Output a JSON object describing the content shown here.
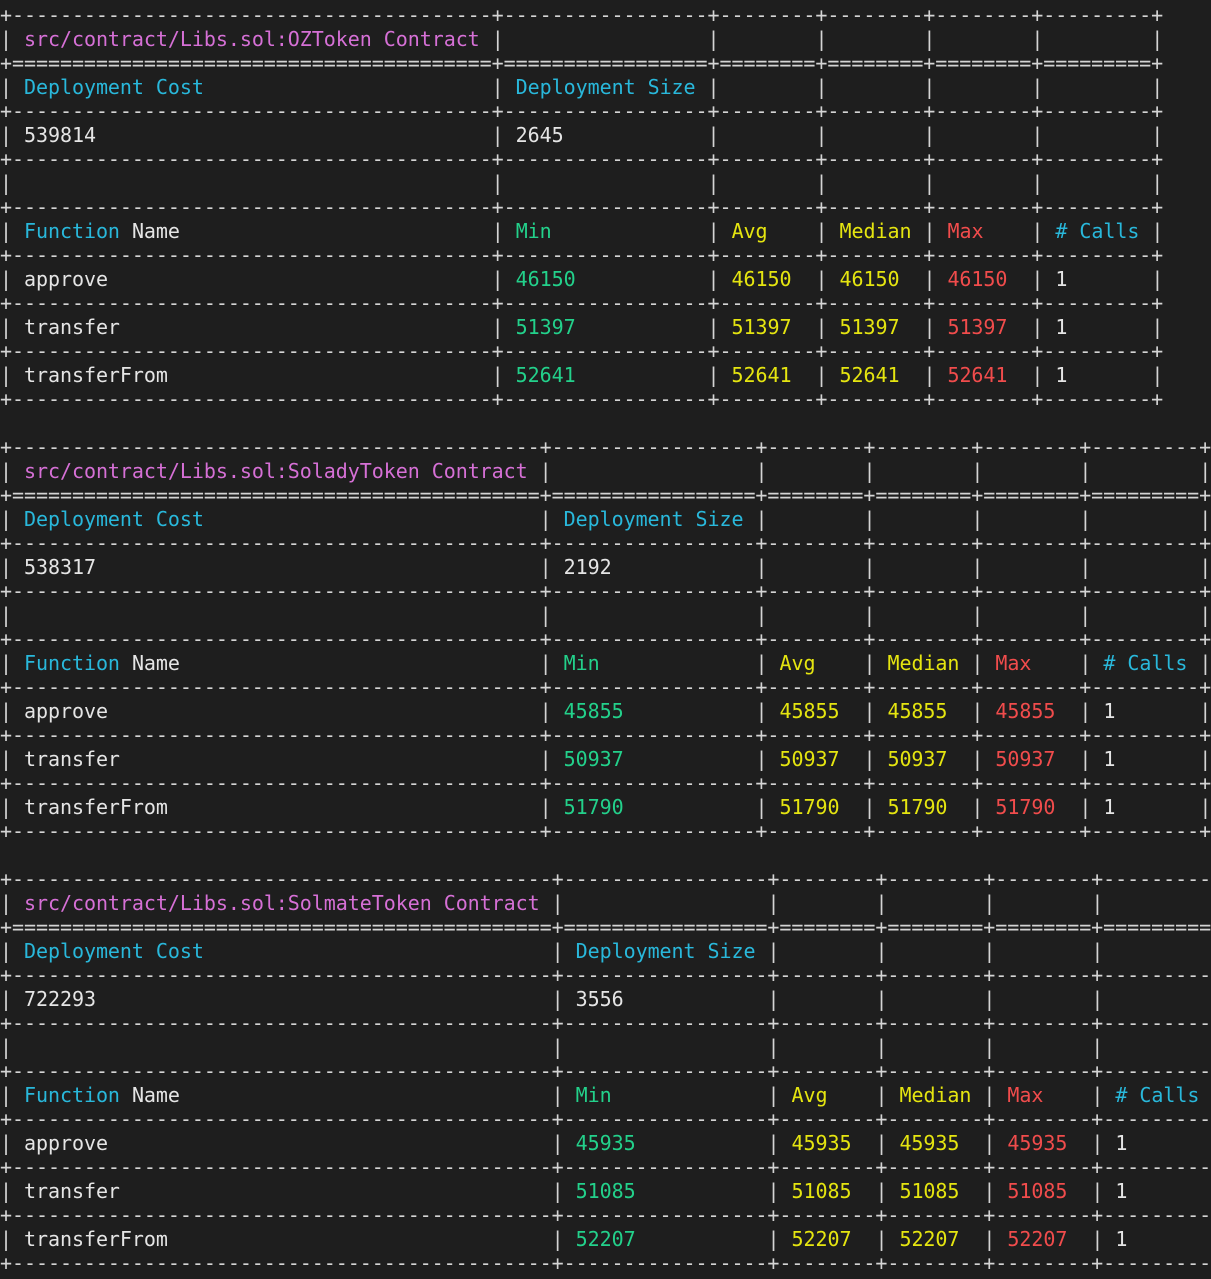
{
  "theme": {
    "background": "#1e1e1e",
    "border": "#d4d4d4",
    "title": "#d670d6",
    "header": "#29b8db",
    "min": "#23d18b",
    "avg_median": "#e5e510",
    "max": "#f14c4c",
    "text": "#e5e5e5"
  },
  "labels": {
    "deployment_cost": "Deployment Cost",
    "deployment_size": "Deployment Size",
    "function_word": "Function",
    "name_word": "Name",
    "min": "Min",
    "avg": "Avg",
    "median": "Median",
    "max": "Max",
    "calls": "# Calls"
  },
  "tables": [
    {
      "id": "oz",
      "contract_path": "src/contract/Libs.sol:OZToken",
      "contract_word": "Contract",
      "deployment_cost": "539814",
      "deployment_size": "2645",
      "functions": [
        {
          "name": "approve",
          "min": "46150",
          "avg": "46150",
          "median": "46150",
          "max": "46150",
          "calls": "1"
        },
        {
          "name": "transfer",
          "min": "51397",
          "avg": "51397",
          "median": "51397",
          "max": "51397",
          "calls": "1"
        },
        {
          "name": "transferFrom",
          "min": "52641",
          "avg": "52641",
          "median": "52641",
          "max": "52641",
          "calls": "1"
        }
      ]
    },
    {
      "id": "solady",
      "contract_path": "src/contract/Libs.sol:SoladyToken",
      "contract_word": "Contract",
      "deployment_cost": "538317",
      "deployment_size": "2192",
      "functions": [
        {
          "name": "approve",
          "min": "45855",
          "avg": "45855",
          "median": "45855",
          "max": "45855",
          "calls": "1"
        },
        {
          "name": "transfer",
          "min": "50937",
          "avg": "50937",
          "median": "50937",
          "max": "50937",
          "calls": "1"
        },
        {
          "name": "transferFrom",
          "min": "51790",
          "avg": "51790",
          "median": "51790",
          "max": "51790",
          "calls": "1"
        }
      ]
    },
    {
      "id": "solmate",
      "contract_path": "src/contract/Libs.sol:SolmateToken",
      "contract_word": "Contract",
      "deployment_cost": "722293",
      "deployment_size": "3556",
      "functions": [
        {
          "name": "approve",
          "min": "45935",
          "avg": "45935",
          "median": "45935",
          "max": "45935",
          "calls": "1"
        },
        {
          "name": "transfer",
          "min": "51085",
          "avg": "51085",
          "median": "51085",
          "max": "51085",
          "calls": "1"
        },
        {
          "name": "transferFrom",
          "min": "52207",
          "avg": "52207",
          "median": "52207",
          "max": "52207",
          "calls": "1"
        }
      ]
    }
  ]
}
